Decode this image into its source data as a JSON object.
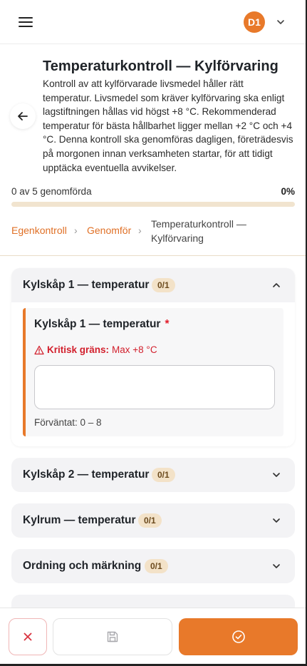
{
  "header": {
    "avatar_initials": "D1"
  },
  "page": {
    "title": "Temperaturkontroll — Kylförvaring",
    "description": "Kontroll av att kylförvarade livsmedel håller rätt temperatur. Livsmedel som kräver kylförvaring ska enligt lagstiftningen hållas vid högst +8 °C. Rekommenderad temperatur för bästa hållbarhet ligger mellan +2 °C och +4 °C. Denna kontroll ska genomföras dagligen, företrädesvis på morgonen innan verksamheten startar, för att tidigt upptäcka eventuella avvikelser."
  },
  "progress": {
    "label": "0 av 5 genomförda",
    "percent_text": "0%",
    "fraction": 0
  },
  "breadcrumb": {
    "items": [
      "Egenkontroll",
      "Genomför"
    ],
    "separator": "›",
    "current": "Temperaturkontroll — Kylförvaring"
  },
  "sections": [
    {
      "title": "Kylskåp 1 — temperatur",
      "badge": "0/1",
      "expanded": true,
      "item": {
        "title": "Kylskåp 1 — temperatur",
        "required_mark": "*",
        "critical_label": "Kritisk gräns:",
        "critical_value": "Max +8 °C",
        "input_value": "",
        "expected": "Förväntat: 0 – 8"
      }
    },
    {
      "title": "Kylskåp 2 — temperatur",
      "badge": "0/1",
      "expanded": false
    },
    {
      "title": "Kylrum — temperatur",
      "badge": "0/1",
      "expanded": false
    },
    {
      "title": "Ordning och märkning",
      "badge": "0/1",
      "expanded": false
    }
  ],
  "colors": {
    "accent": "#e8792a",
    "danger": "#d21f2c",
    "badge_bg": "#f3e2c8"
  },
  "icons": {
    "menu": "hamburger-icon",
    "user_menu": "chevron-down-icon",
    "back": "arrow-left-icon",
    "cancel": "x-icon",
    "save": "floppy-disk-icon",
    "submit": "check-circle-icon"
  }
}
